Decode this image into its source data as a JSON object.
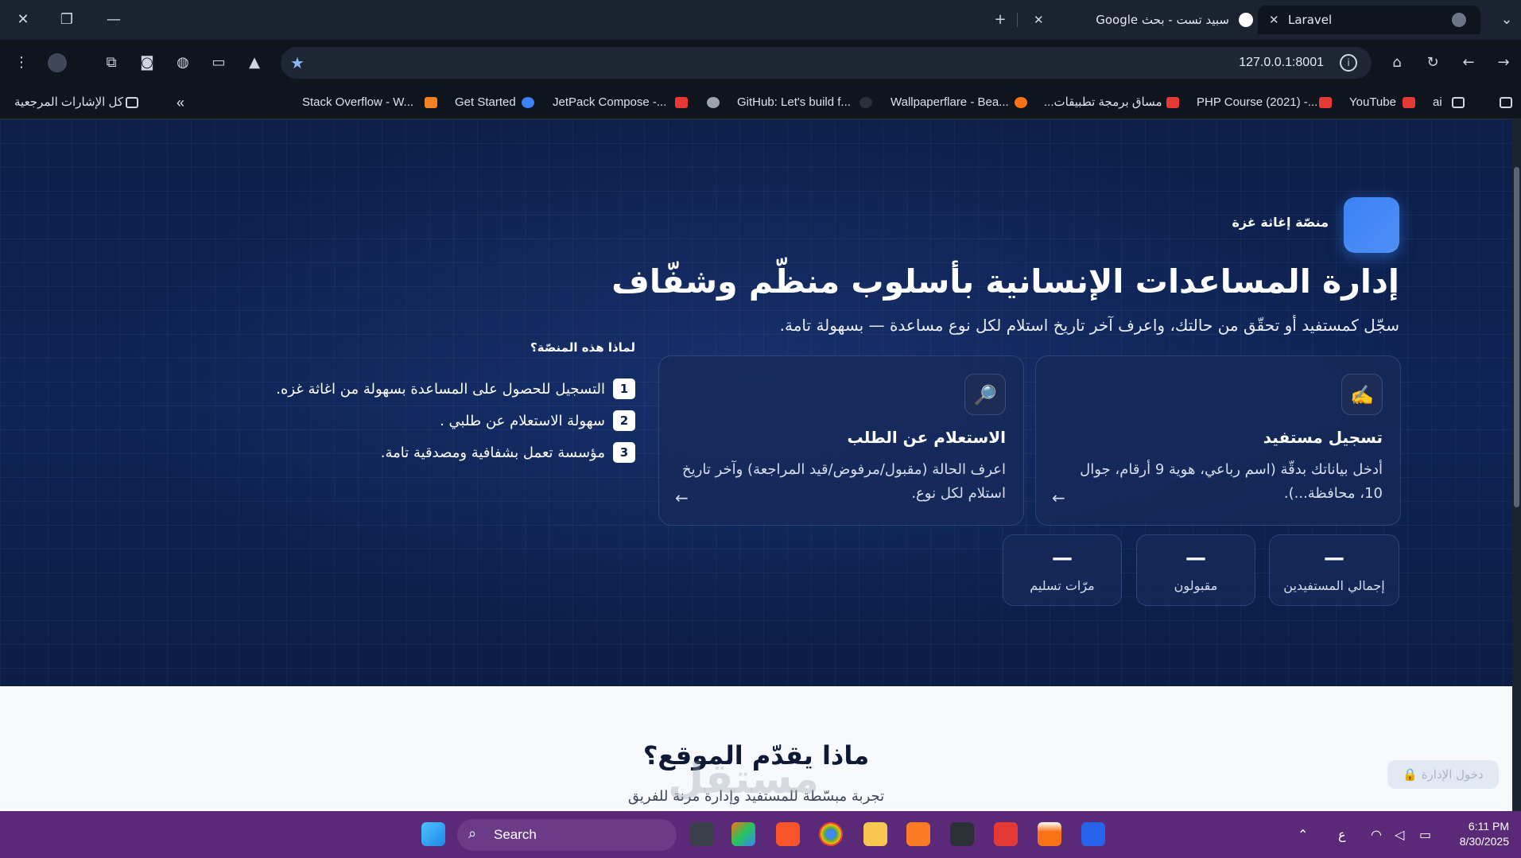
{
  "browser": {
    "tabs": [
      {
        "title": "Laravel",
        "active": true
      },
      {
        "title": "سبيد تست - بحث Google",
        "active": false
      }
    ],
    "url": "127.0.0.1:8001",
    "bookmarks": [
      "ai",
      "YouTube",
      "PHP Course (2021) -...",
      "مساق برمجة تطبيقات...",
      "Wallpaperflare - Bea...",
      "GitHub: Let's build f...",
      "JetPack Compose -...",
      "Get Started",
      "Stack Overflow - W...",
      "كل الإشارات المرجعية"
    ]
  },
  "hero": {
    "brand": "منصّة إغاثة غزة",
    "title": "إدارة المساعدات الإنسانية بأسلوب منظّم وشفّاف",
    "subtitle": "سجّل كمستفيد أو تحقّق من حالتك، واعرف آخر تاريخ استلام لكل نوع مساعدة — بسهولة تامة.",
    "cards": [
      {
        "icon": "✍️",
        "title": "تسجيل مستفيد",
        "desc": "أدخل بياناتك بدقّة (اسم رباعي، هوية 9 أرقام، جوال 10، محافظة...).",
        "arrow": "←"
      },
      {
        "icon": "🔎",
        "title": "الاستعلام عن الطلب",
        "desc": "اعرف الحالة (مقبول/مرفوض/قيد المراجعة) وآخر تاريخ استلام لكل نوع.",
        "arrow": "←"
      }
    ],
    "why": {
      "title": "لماذا هذه المنصّة؟",
      "items": [
        {
          "num": "1",
          "text": "التسجيل للحصول على المساعدة بسهولة من اغاثة غزه."
        },
        {
          "num": "2",
          "text": "سهولة الاستعلام عن طلبي ."
        },
        {
          "num": "3",
          "text": "مؤسسة تعمل بشفافية ومصدقية تامة."
        }
      ]
    },
    "stats": [
      {
        "value": "—",
        "label": "إجمالي المستفيدين"
      },
      {
        "value": "—",
        "label": "مقبولون"
      },
      {
        "value": "—",
        "label": "مرّات تسليم"
      }
    ]
  },
  "features": {
    "title": "ماذا يقدّم الموقع؟",
    "subtitle": "تجربة مبسّطة للمستفيد وإدارة مرنة للفريق",
    "admin_button": "دخول الإدارة 🔒"
  },
  "taskbar": {
    "search_label": "Search",
    "language": "ع",
    "time": "6:11 PM",
    "date": "8/30/2025"
  },
  "watermark": "مستقل",
  "colors": {
    "hero_bg": "#0e2456",
    "accent": "#3b82f6",
    "taskbar": "#5a2a78"
  }
}
